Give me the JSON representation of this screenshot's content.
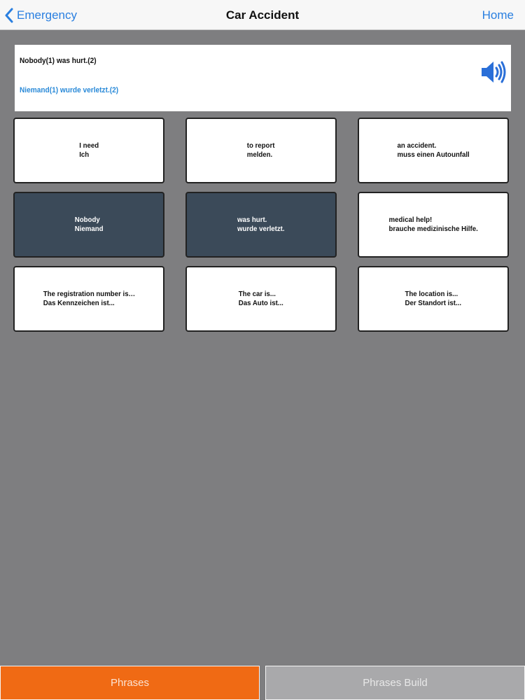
{
  "nav": {
    "back_label": "Emergency",
    "title": "Car Accident",
    "home_label": "Home"
  },
  "sentence": {
    "english": "Nobody(1) was hurt.(2)",
    "german": "Niemand(1) wurde verletzt.(2)",
    "speaker_icon": "speaker-icon"
  },
  "tiles": [
    {
      "en": "I need",
      "de": "Ich",
      "selected": false
    },
    {
      "en": "to report",
      "de": "melden.",
      "selected": false
    },
    {
      "en": "an accident.",
      "de": "muss einen Autounfall",
      "selected": false
    },
    {
      "en": "Nobody",
      "de": "Niemand",
      "selected": true
    },
    {
      "en": "was hurt.",
      "de": "wurde verletzt.",
      "selected": true
    },
    {
      "en": "medical help!",
      "de": "brauche medizinische Hilfe.",
      "selected": false
    },
    {
      "en": "The registration number is…",
      "de": "Das Kennzeichen ist...",
      "selected": false
    },
    {
      "en": "The car is...",
      "de": "Das Auto ist...",
      "selected": false
    },
    {
      "en": "The location is...",
      "de": "Der Standort ist...",
      "selected": false
    }
  ],
  "tabs": [
    {
      "label": "Phrases",
      "active": true
    },
    {
      "label": "Phrases Build",
      "active": false
    }
  ],
  "colors": {
    "accent_blue": "#2a7fe0",
    "selected_tile": "#3b4a59",
    "active_tab": "#f06a14",
    "inactive_tab": "#a9a9ab",
    "background": "#7e7e80"
  }
}
